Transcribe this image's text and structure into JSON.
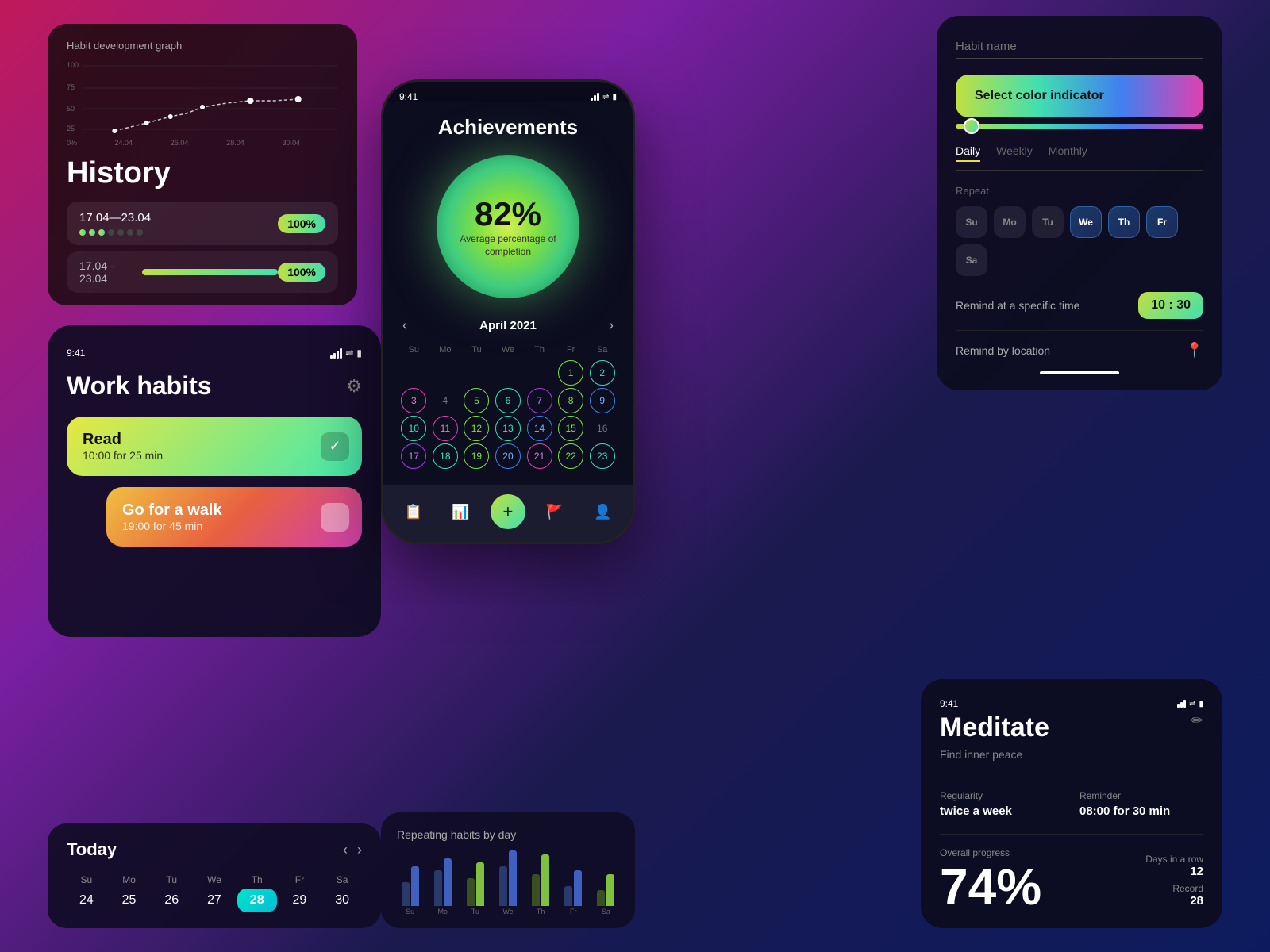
{
  "history": {
    "graph_title": "Habit development graph",
    "title": "History",
    "range1": "17.04—23.04",
    "range2": "17.04 - 23.04",
    "badge1": "100%",
    "badge2": "100%",
    "y_labels": [
      "100",
      "75",
      "50",
      "25",
      "0%"
    ],
    "x_labels": [
      "24.04",
      "26.04",
      "28.04",
      "30.04"
    ]
  },
  "work_habits": {
    "status_time": "9:41",
    "title": "Work habits",
    "habit1_name": "Read",
    "habit1_time": "10:00 for 25 min",
    "habit2_name": "Go for a walk",
    "habit2_time": "19:00 for 45 min"
  },
  "today_section": {
    "title": "Today",
    "day_labels": [
      "Su",
      "Mo",
      "Tu",
      "We",
      "Th",
      "Fr",
      "Sa"
    ],
    "day_nums": [
      "24",
      "25",
      "26",
      "27",
      "28",
      "29",
      "30"
    ],
    "today_index": 4
  },
  "achievements": {
    "status_time": "9:41",
    "title": "Achievements",
    "percentage": "82%",
    "subtitle": "Average percentage of\ncompletion",
    "month": "April 2021",
    "day_labels": [
      "Su",
      "Mo",
      "Tu",
      "We",
      "Th",
      "Fr",
      "Sa"
    ],
    "calendar_rows": [
      [
        "",
        "",
        "",
        "",
        "1",
        "2",
        ""
      ],
      [
        "3",
        "4",
        "5",
        "6",
        "7",
        "8",
        "9"
      ],
      [
        "10",
        "11",
        "12",
        "13",
        "14",
        "15",
        "16"
      ],
      [
        "17",
        "18",
        "19",
        "20",
        "21",
        "22",
        "23"
      ]
    ],
    "tab_icons": [
      "📋",
      "📊",
      "+",
      "🚩",
      "👤"
    ]
  },
  "repeating_habits": {
    "title": "Repeating habits by day"
  },
  "settings": {
    "habit_name_placeholder": "Habit name",
    "color_label": "Select color indicator",
    "freq_tabs": [
      "Daily",
      "Weekly",
      "Monthly"
    ],
    "active_tab": "Daily",
    "repeat_label": "Repeat",
    "days": [
      "Su",
      "Mo",
      "Tu",
      "We",
      "Th",
      "Fr",
      "Sa"
    ],
    "selected_days": [
      3,
      4,
      5
    ],
    "remind_time_label": "Remind at a specific time",
    "remind_time": "10 : 30",
    "remind_location_label": "Remind by location"
  },
  "meditate": {
    "status_time": "9:41",
    "title": "Meditate",
    "subtitle": "Find inner peace",
    "edit_icon": "✏",
    "regularity_key": "Regularity",
    "regularity_val": "twice a week",
    "reminder_key": "Reminder",
    "reminder_val": "08:00 for 30 min",
    "progress_key": "Overall progress",
    "progress_val": "74%",
    "days_row_key": "Days in a row",
    "days_row_val": "12",
    "record_key": "Record",
    "record_val": "28"
  },
  "colors": {
    "accent_green": "#c0e040",
    "accent_teal": "#40e0b0",
    "accent_blue": "#4080f0",
    "accent_pink": "#e040b0",
    "dark_bg": "#0d0d20",
    "card_bg": "#12122a"
  }
}
